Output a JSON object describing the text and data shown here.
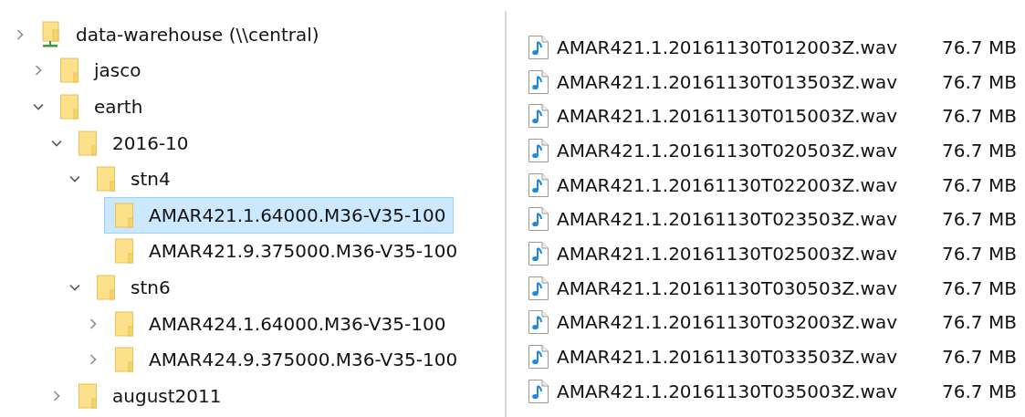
{
  "tree": [
    {
      "label": "data-warehouse (\\\\central)",
      "kind": "drive",
      "expanded": false,
      "selected": false,
      "children": [
        {
          "label": "jasco",
          "kind": "folder",
          "expanded": false,
          "selected": false
        },
        {
          "label": "earth",
          "kind": "folder",
          "expanded": true,
          "selected": false,
          "children": [
            {
              "label": "2016-10",
              "kind": "folder",
              "expanded": true,
              "selected": false,
              "children": [
                {
                  "label": "stn4",
                  "kind": "folder",
                  "expanded": true,
                  "selected": false,
                  "children": [
                    {
                      "label": "AMAR421.1.64000.M36-V35-100",
                      "kind": "folder",
                      "selected": true
                    },
                    {
                      "label": "AMAR421.9.375000.M36-V35-100",
                      "kind": "folder",
                      "selected": false
                    }
                  ]
                },
                {
                  "label": "stn6",
                  "kind": "folder",
                  "expanded": true,
                  "selected": false,
                  "children": [
                    {
                      "label": "AMAR424.1.64000.M36-V35-100",
                      "kind": "folder",
                      "expanded": false,
                      "selected": false
                    },
                    {
                      "label": "AMAR424.9.375000.M36-V35-100",
                      "kind": "folder",
                      "expanded": false,
                      "selected": false
                    }
                  ]
                }
              ]
            },
            {
              "label": "august2011",
              "kind": "folder",
              "expanded": false,
              "selected": false
            }
          ]
        }
      ]
    }
  ],
  "files": [
    {
      "name": "AMAR421.1.20161130T012003Z.wav",
      "size": "76.7 MB"
    },
    {
      "name": "AMAR421.1.20161130T013503Z.wav",
      "size": "76.7 MB"
    },
    {
      "name": "AMAR421.1.20161130T015003Z.wav",
      "size": "76.7 MB"
    },
    {
      "name": "AMAR421.1.20161130T020503Z.wav",
      "size": "76.7 MB"
    },
    {
      "name": "AMAR421.1.20161130T022003Z.wav",
      "size": "76.7 MB"
    },
    {
      "name": "AMAR421.1.20161130T023503Z.wav",
      "size": "76.7 MB"
    },
    {
      "name": "AMAR421.1.20161130T025003Z.wav",
      "size": "76.7 MB"
    },
    {
      "name": "AMAR421.1.20161130T030503Z.wav",
      "size": "76.7 MB"
    },
    {
      "name": "AMAR421.1.20161130T032003Z.wav",
      "size": "76.7 MB"
    },
    {
      "name": "AMAR421.1.20161130T033503Z.wav",
      "size": "76.7 MB"
    },
    {
      "name": "AMAR421.1.20161130T035003Z.wav",
      "size": "76.7 MB"
    }
  ]
}
